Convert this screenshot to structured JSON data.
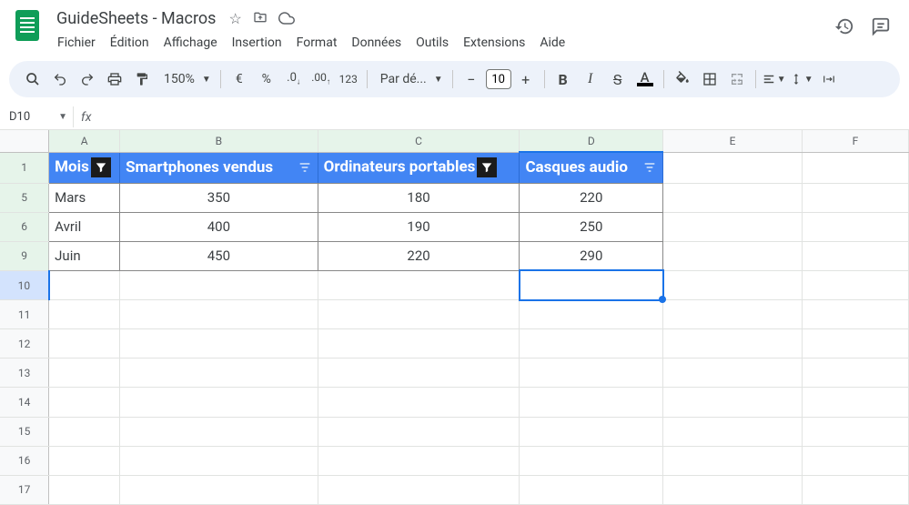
{
  "doc_title": "GuideSheets - Macros",
  "menus": [
    "Fichier",
    "Édition",
    "Affichage",
    "Insertion",
    "Format",
    "Données",
    "Outils",
    "Extensions",
    "Aide"
  ],
  "toolbar": {
    "zoom": "150%",
    "currency": "€",
    "percent": "%",
    "dec_dec": ".0",
    "inc_dec": ".00",
    "num_fmt": "123",
    "font": "Par dé...",
    "font_size": "10"
  },
  "name_box": "D10",
  "columns": [
    "A",
    "B",
    "C",
    "D",
    "E",
    "F"
  ],
  "visible_rows": [
    "1",
    "5",
    "6",
    "9",
    "10",
    "11",
    "12",
    "13",
    "14",
    "15",
    "16",
    "17"
  ],
  "active_cell": {
    "row": "10",
    "col": "D"
  },
  "headers": {
    "A": "Mois",
    "B": "Smartphones vendus",
    "C": "Ordinateurs portables",
    "D": "Casques audio"
  },
  "data_rows": [
    {
      "row": "5",
      "A": "Mars",
      "B": "350",
      "C": "180",
      "D": "220"
    },
    {
      "row": "6",
      "A": "Avril",
      "B": "400",
      "C": "190",
      "D": "250"
    },
    {
      "row": "9",
      "A": "Juin",
      "B": "450",
      "C": "220",
      "D": "290"
    }
  ],
  "chart_data": {
    "type": "table",
    "title": "",
    "categories": [
      "Mars",
      "Avril",
      "Juin"
    ],
    "series": [
      {
        "name": "Smartphones vendus",
        "values": [
          350,
          400,
          450
        ]
      },
      {
        "name": "Ordinateurs portables",
        "values": [
          180,
          190,
          220
        ]
      },
      {
        "name": "Casques audio",
        "values": [
          220,
          250,
          290
        ]
      }
    ]
  }
}
